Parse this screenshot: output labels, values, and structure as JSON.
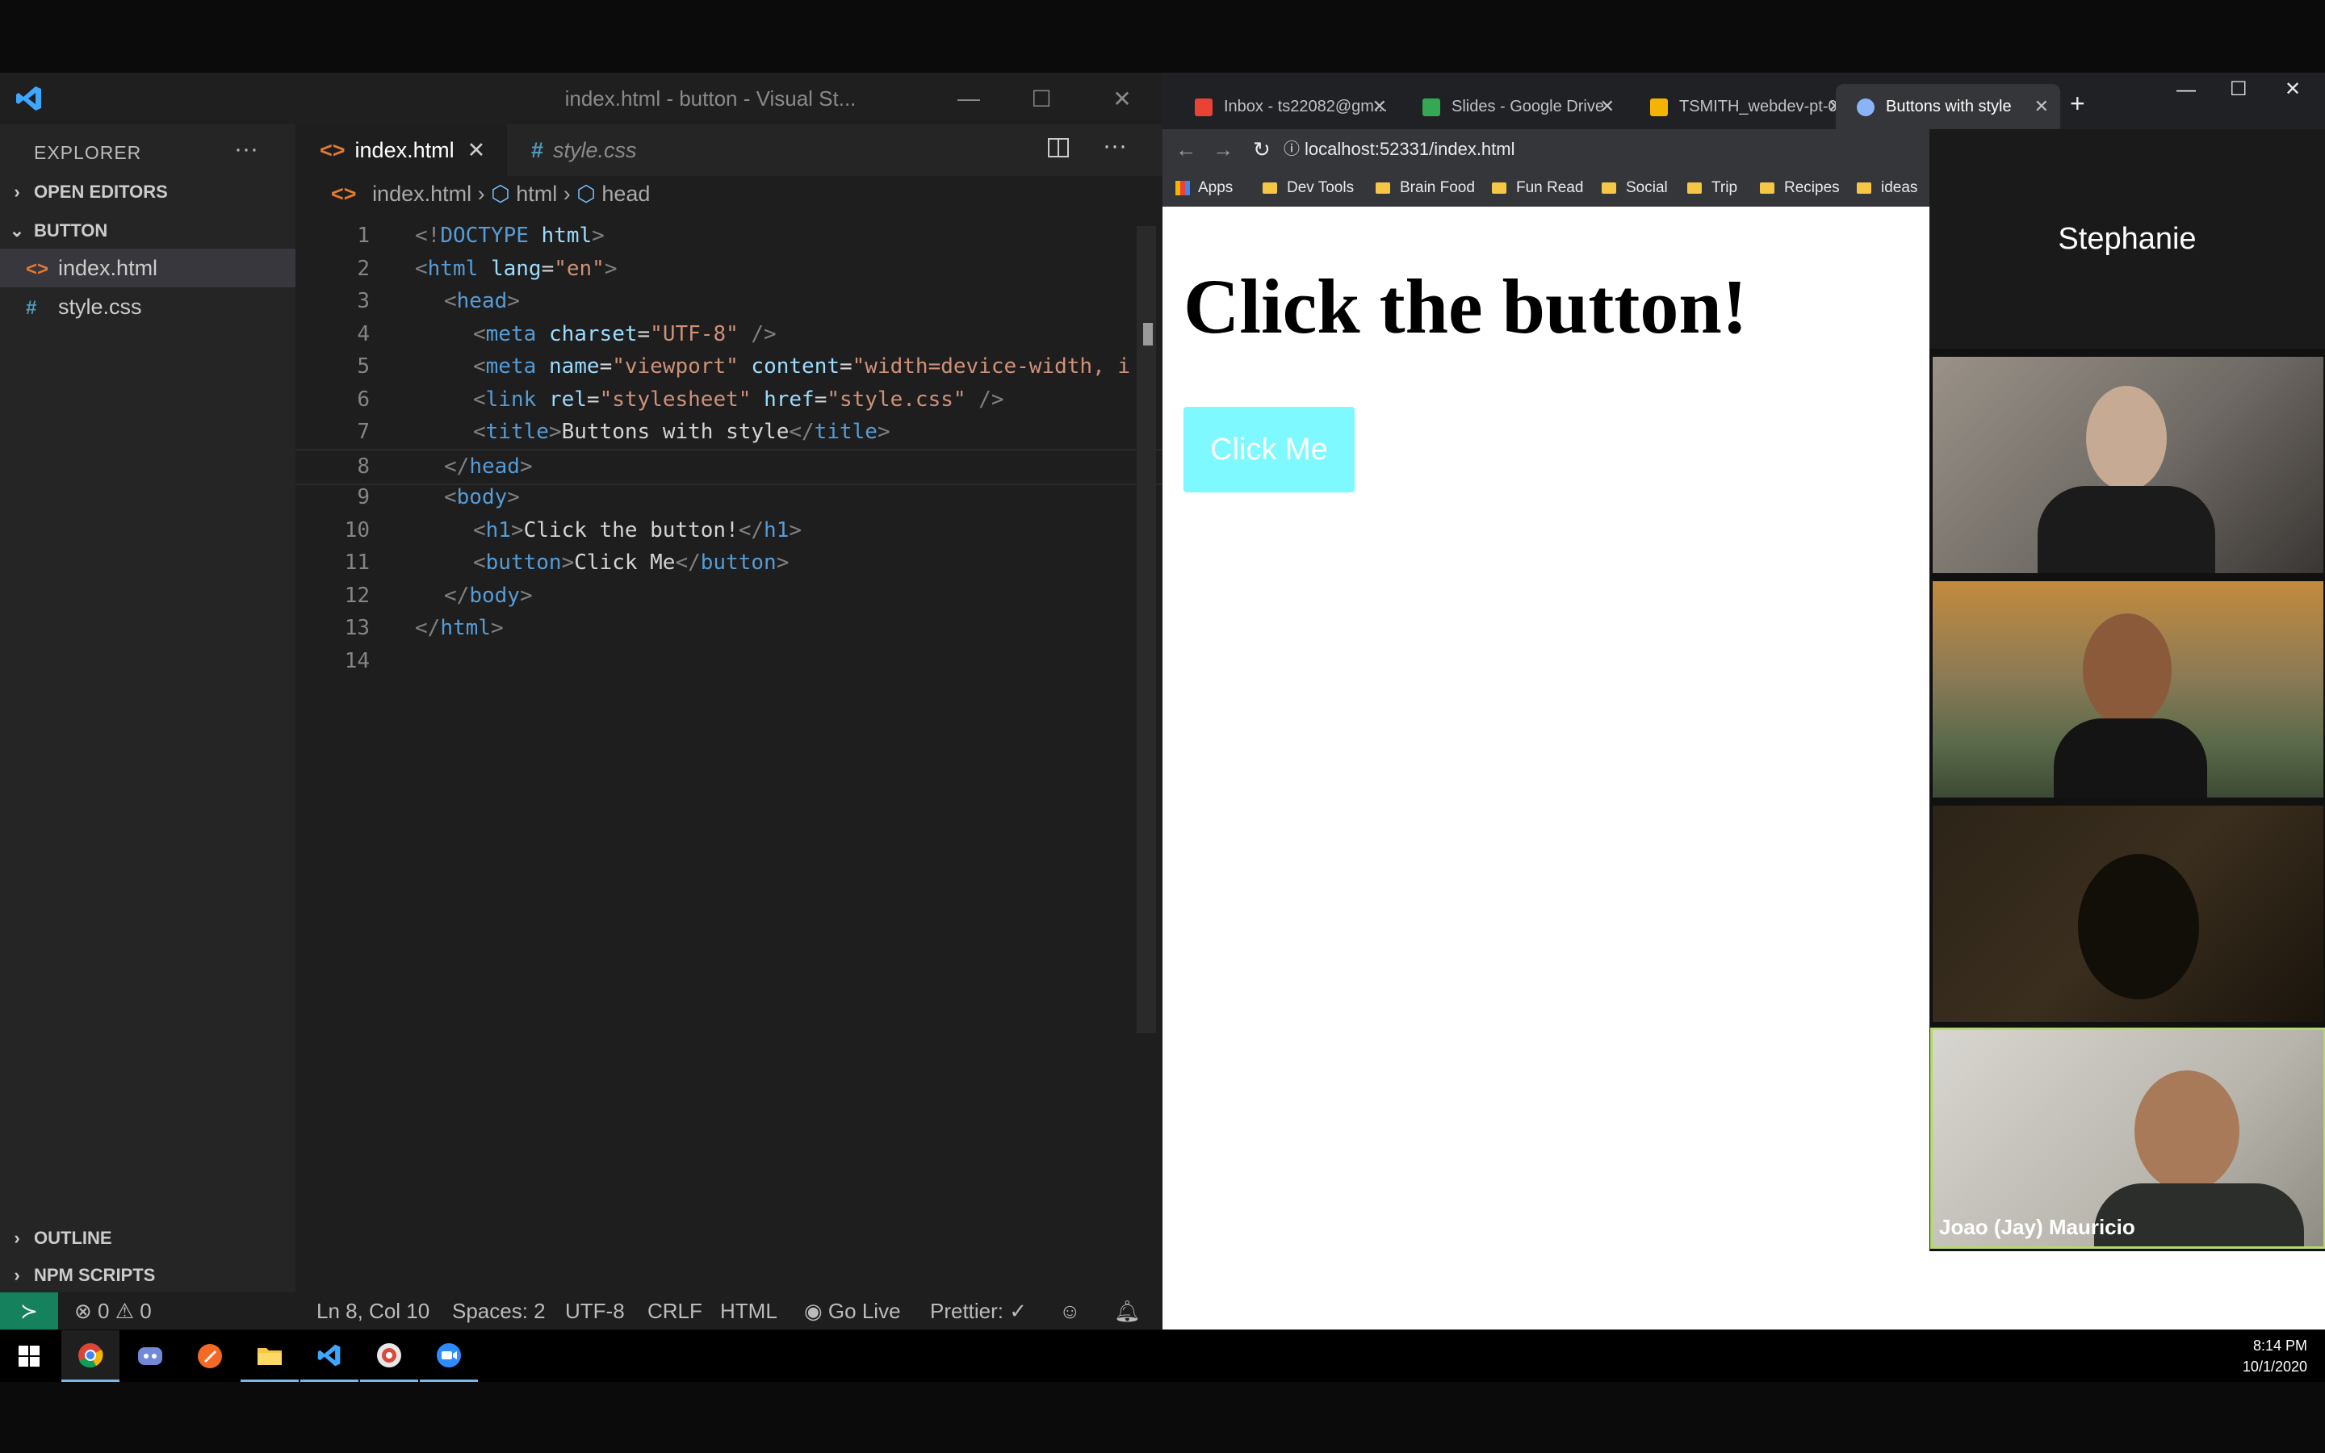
{
  "vscode": {
    "window_title": "index.html - button - Visual St...",
    "explorer_title": "EXPLORER",
    "sections": {
      "open_editors": "OPEN EDITORS",
      "folder": "BUTTON",
      "outline": "OUTLINE",
      "npm_scripts": "NPM SCRIPTS"
    },
    "files": [
      {
        "icon": "<>",
        "name": "index.html",
        "active": true
      },
      {
        "icon": "#",
        "name": "style.css",
        "active": false
      }
    ],
    "tabs": [
      {
        "icon": "<>",
        "label": "index.html",
        "active": true
      },
      {
        "icon": "#",
        "label": "style.css",
        "active": false
      }
    ],
    "breadcrumb": {
      "file": "index.html",
      "html": "html",
      "head": "head"
    },
    "code": [
      {
        "n": "1",
        "indent": 0,
        "parts": [
          [
            "tag",
            "<!"
          ],
          [
            "name",
            "DOCTYPE"
          ],
          [
            "txt",
            " "
          ],
          [
            "attr",
            "html"
          ],
          [
            "tag",
            ">"
          ]
        ]
      },
      {
        "n": "2",
        "indent": 0,
        "parts": [
          [
            "tag",
            "<"
          ],
          [
            "name",
            "html"
          ],
          [
            "txt",
            " "
          ],
          [
            "attr",
            "lang"
          ],
          [
            "txt",
            "="
          ],
          [
            "str",
            "\"en\""
          ],
          [
            "tag",
            ">"
          ]
        ]
      },
      {
        "n": "3",
        "indent": 1,
        "parts": [
          [
            "tag",
            "<"
          ],
          [
            "name",
            "head"
          ],
          [
            "tag",
            ">"
          ]
        ]
      },
      {
        "n": "4",
        "indent": 2,
        "parts": [
          [
            "tag",
            "<"
          ],
          [
            "name",
            "meta"
          ],
          [
            "txt",
            " "
          ],
          [
            "attr",
            "charset"
          ],
          [
            "txt",
            "="
          ],
          [
            "str",
            "\"UTF-8\""
          ],
          [
            "txt",
            " "
          ],
          [
            "tag",
            "/>"
          ]
        ]
      },
      {
        "n": "5",
        "indent": 2,
        "parts": [
          [
            "tag",
            "<"
          ],
          [
            "name",
            "meta"
          ],
          [
            "txt",
            " "
          ],
          [
            "attr",
            "name"
          ],
          [
            "txt",
            "="
          ],
          [
            "str",
            "\"viewport\""
          ],
          [
            "txt",
            " "
          ],
          [
            "attr",
            "content"
          ],
          [
            "txt",
            "="
          ],
          [
            "str",
            "\"width=device-width, i"
          ]
        ]
      },
      {
        "n": "6",
        "indent": 2,
        "parts": [
          [
            "tag",
            "<"
          ],
          [
            "name",
            "link"
          ],
          [
            "txt",
            " "
          ],
          [
            "attr",
            "rel"
          ],
          [
            "txt",
            "="
          ],
          [
            "str",
            "\"stylesheet\""
          ],
          [
            "txt",
            " "
          ],
          [
            "attr",
            "href"
          ],
          [
            "txt",
            "="
          ],
          [
            "str",
            "\"style.css\""
          ],
          [
            "txt",
            " "
          ],
          [
            "tag",
            "/>"
          ]
        ]
      },
      {
        "n": "7",
        "indent": 2,
        "parts": [
          [
            "tag",
            "<"
          ],
          [
            "name",
            "title"
          ],
          [
            "tag",
            ">"
          ],
          [
            "txt",
            "Buttons with style"
          ],
          [
            "tag",
            "</"
          ],
          [
            "name",
            "title"
          ],
          [
            "tag",
            ">"
          ]
        ]
      },
      {
        "n": "8",
        "indent": 1,
        "parts": [
          [
            "tag",
            "</"
          ],
          [
            "name",
            "head"
          ],
          [
            "tag",
            ">"
          ]
        ]
      },
      {
        "n": "9",
        "indent": 1,
        "parts": [
          [
            "tag",
            "<"
          ],
          [
            "name",
            "body"
          ],
          [
            "tag",
            ">"
          ]
        ]
      },
      {
        "n": "10",
        "indent": 2,
        "parts": [
          [
            "tag",
            "<"
          ],
          [
            "name",
            "h1"
          ],
          [
            "tag",
            ">"
          ],
          [
            "txt",
            "Click the button!"
          ],
          [
            "tag",
            "</"
          ],
          [
            "name",
            "h1"
          ],
          [
            "tag",
            ">"
          ]
        ]
      },
      {
        "n": "11",
        "indent": 2,
        "parts": [
          [
            "tag",
            "<"
          ],
          [
            "name",
            "button"
          ],
          [
            "tag",
            ">"
          ],
          [
            "txt",
            "Click Me"
          ],
          [
            "tag",
            "</"
          ],
          [
            "name",
            "button"
          ],
          [
            "tag",
            ">"
          ]
        ]
      },
      {
        "n": "12",
        "indent": 1,
        "parts": [
          [
            "tag",
            "</"
          ],
          [
            "name",
            "body"
          ],
          [
            "tag",
            ">"
          ]
        ]
      },
      {
        "n": "13",
        "indent": 0,
        "parts": [
          [
            "tag",
            "</"
          ],
          [
            "name",
            "html"
          ],
          [
            "tag",
            ">"
          ]
        ]
      },
      {
        "n": "14",
        "indent": 0,
        "parts": []
      }
    ],
    "status": {
      "errors": "0",
      "warnings": "0",
      "position": "Ln 8, Col 10",
      "spaces": "Spaces: 2",
      "encoding": "UTF-8",
      "eol": "CRLF",
      "language": "HTML",
      "go_live": "Go Live",
      "prettier": "Prettier: ✓"
    }
  },
  "chrome": {
    "tabs": [
      {
        "label": "Inbox - ts22082@gm...",
        "favicon_color": "#ea4335",
        "active": false
      },
      {
        "label": "Slides - Google Drive",
        "favicon_color": "#34a853",
        "active": false
      },
      {
        "label": "TSMITH_webdev-pt-0...",
        "favicon_color": "#f4b400",
        "active": false
      },
      {
        "label": "Buttons with style",
        "favicon_color": "#8ab4f8",
        "active": true
      }
    ],
    "url": "localhost:52331/index.html",
    "bookmarks": [
      "Apps",
      "Dev Tools",
      "Brain Food",
      "Fun Read",
      "Social",
      "Trip",
      "Recipes",
      "ideas"
    ],
    "page": {
      "heading": "Click the button!",
      "button_label": "Click Me"
    }
  },
  "zoom": {
    "name_tile": "Stephanie",
    "active_speaker_label": "Joao (Jay) Mauricio"
  },
  "taskbar": {
    "time": "8:14 PM",
    "date": "10/1/2020",
    "apps": [
      "chrome-icon",
      "discord-icon",
      "sketch-icon",
      "file-explorer-icon",
      "vscode-icon",
      "chrome-canary-icon",
      "zoom-icon"
    ]
  }
}
